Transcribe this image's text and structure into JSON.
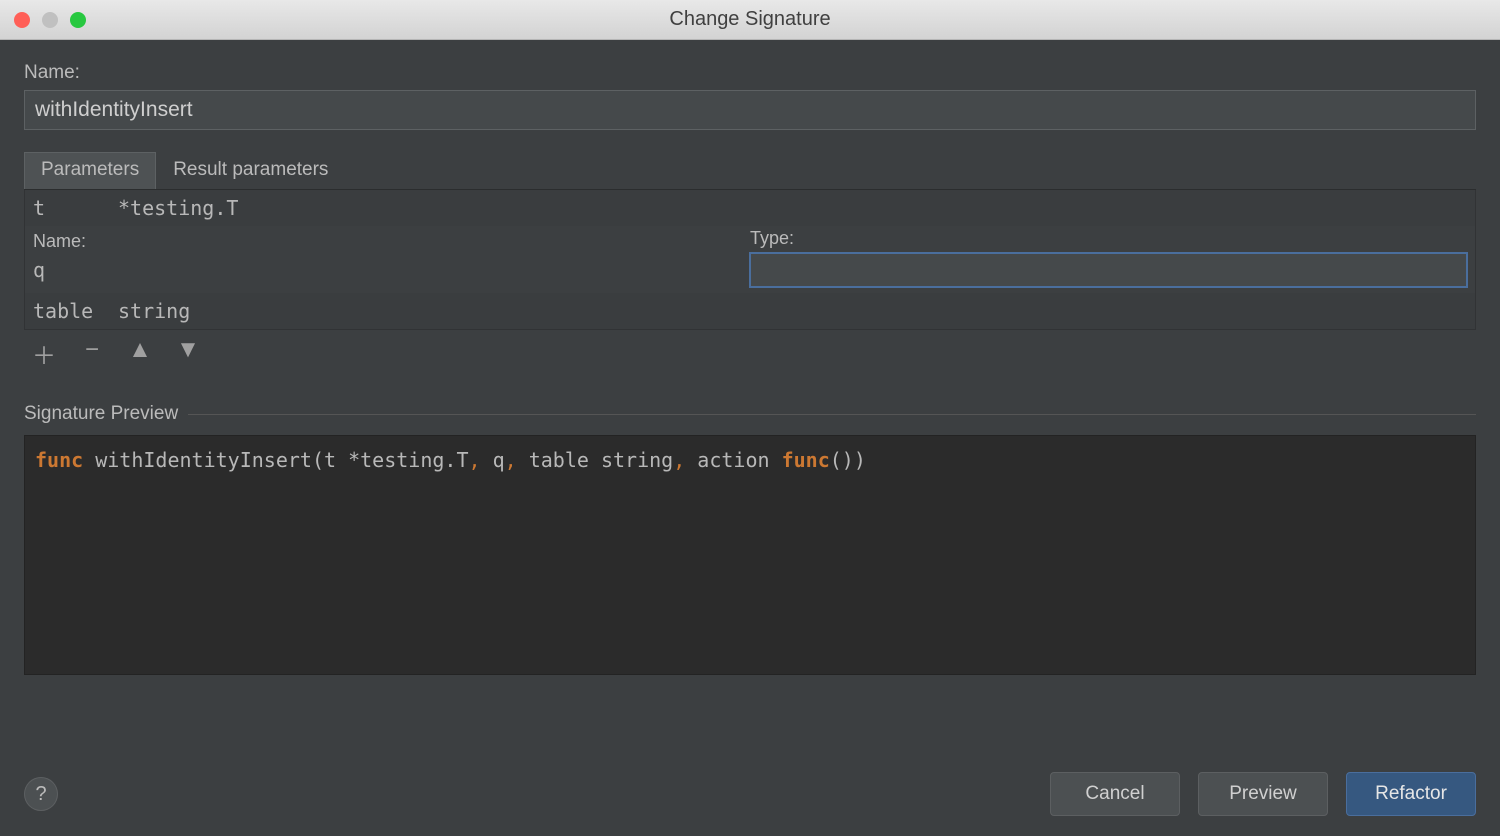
{
  "window": {
    "title": "Change Signature"
  },
  "name_section": {
    "label": "Name:",
    "value": "withIdentityInsert"
  },
  "tabs": {
    "parameters": "Parameters",
    "result_parameters": "Result parameters"
  },
  "params": {
    "rows": [
      {
        "name": "t",
        "type": "*testing.T"
      },
      {
        "name": "q",
        "type": ""
      },
      {
        "name": "table",
        "type": "string"
      }
    ],
    "edit_labels": {
      "name": "Name:",
      "type": "Type:"
    },
    "type_input_value": ""
  },
  "toolbar": {
    "add": "＋",
    "del": "−",
    "up": "▲",
    "down": "▼"
  },
  "preview": {
    "label": "Signature Preview",
    "tokens": {
      "kw_func": "func",
      "fn": " withIdentityInsert(t *testing.T",
      "c1": ",",
      "p2": " q",
      "c2": ",",
      "p3": " table string",
      "c3": ",",
      "p4": " action ",
      "kw_func2": "func",
      "tail": "())"
    }
  },
  "footer": {
    "help": "?",
    "cancel": "Cancel",
    "preview": "Preview",
    "refactor": "Refactor"
  }
}
